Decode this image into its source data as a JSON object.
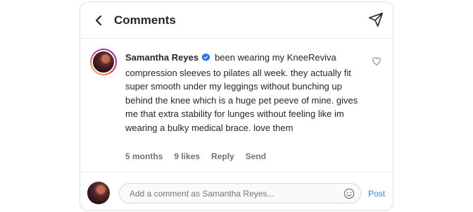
{
  "header": {
    "title": "Comments"
  },
  "comment": {
    "username": "Samantha Reyes",
    "text": "been wearing my KneeReviva compression sleeves to pilates all week. they actually fit super smooth under my leggings without bunching up behind the knee which is a huge pet peeve of mine. gives me that extra stability for lunges without feeling like im wearing a bulky medical brace. love them",
    "time": "5 months",
    "likes": "9 likes",
    "reply_label": "Reply",
    "send_label": "Send"
  },
  "footer": {
    "placeholder": "Add a comment as Samantha Reyes...",
    "post_label": "Post"
  },
  "icons": {
    "back": "chevron-left-icon",
    "share": "paper-plane-icon",
    "verified": "verified-badge-icon",
    "like": "heart-icon",
    "emoji": "smiley-icon"
  },
  "colors": {
    "accent": "#3b82f6",
    "verified": "#1877f2",
    "muted": "#737373"
  }
}
